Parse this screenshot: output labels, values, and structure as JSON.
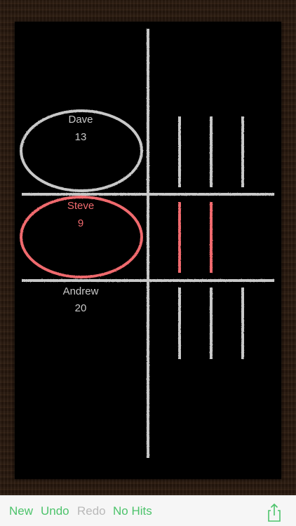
{
  "players": [
    {
      "name": "Dave",
      "score": "13",
      "status": "inactive"
    },
    {
      "name": "Steve",
      "score": "9",
      "status": "active"
    },
    {
      "name": "Andrew",
      "score": "20",
      "status": "inactive"
    }
  ],
  "toolbar": {
    "new_label": "New",
    "undo_label": "Undo",
    "redo_label": "Redo",
    "no_hits_label": "No Hits",
    "share_icon": "share-icon"
  },
  "colors": {
    "chalk": "#c8c8c8",
    "active_red": "#f06a6e",
    "toolbar_green": "#4cc36b",
    "toolbar_disabled": "#b9b9b9"
  },
  "hit_marks": {
    "row_1": 3,
    "row_2": 2,
    "row_3": 3
  }
}
